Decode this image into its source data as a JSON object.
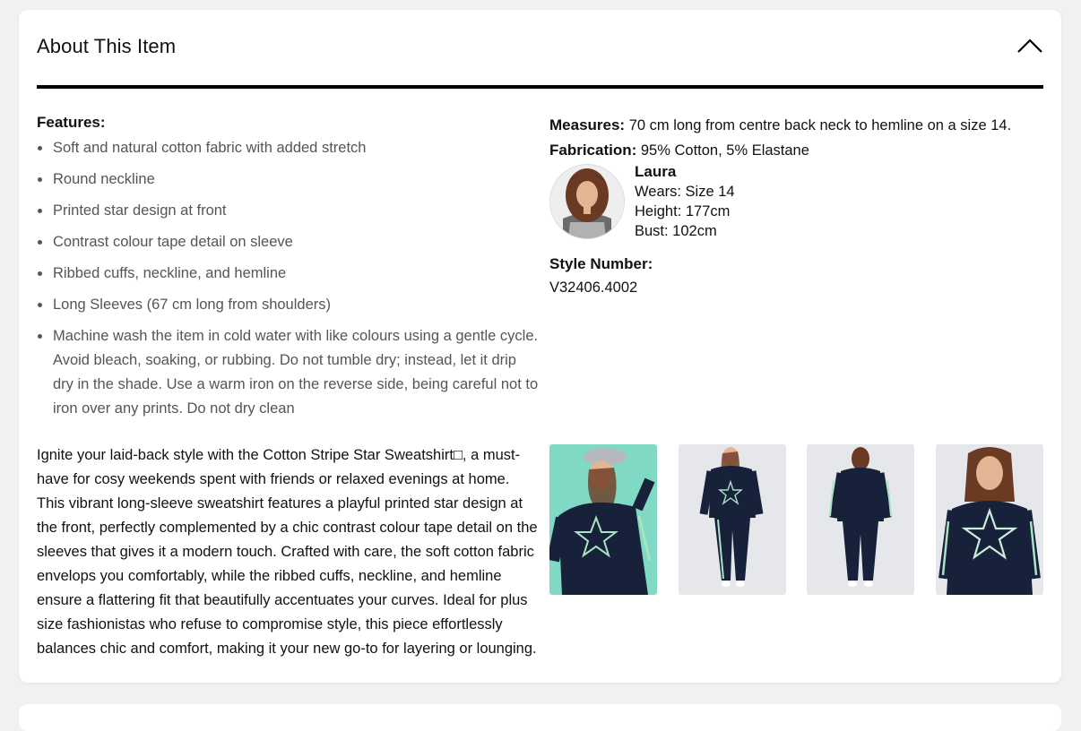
{
  "section": {
    "title": "About This Item"
  },
  "features": {
    "title": "Features:",
    "items": [
      "Soft and natural cotton fabric with added stretch",
      "Round neckline",
      "Printed star design at front",
      "Contrast colour tape detail on sleeve",
      "Ribbed cuffs, neckline, and hemline",
      "Long Sleeves (67 cm long from shoulders)",
      "Machine wash the item in cold water with like colours using a gentle cycle. Avoid bleach, soaking, or rubbing. Do not tumble dry; instead, let it drip dry in the shade. Use a warm iron on the reverse side, being careful not to iron over any prints. Do not dry clean"
    ]
  },
  "description": "Ignite your laid-back style with the Cotton Stripe Star Sweatshirt□, a must-have for cosy weekends spent with friends or relaxed evenings at home. This vibrant long-sleeve sweatshirt features a playful printed star design at the front, perfectly complemented by a chic contrast colour tape detail on the sleeves that gives it a modern touch. Crafted with care, the soft cotton fabric envelops you comfortably, while the ribbed cuffs, neckline, and hemline ensure a flattering fit that beautifully accentuates your curves. Ideal for plus size fashionistas who refuse to compromise style, this piece effortlessly balances chic and comfort, making it your new go-to for layering or lounging.",
  "specs": {
    "measures_label": "Measures:",
    "measures_value": " 70 cm long from centre back neck to hemline on a size 14.",
    "fabrication_label": "Fabrication:",
    "fabrication_value": " 95% Cotton, 5% Elastane"
  },
  "model": {
    "name": "Laura",
    "wears": "Wears: Size 14",
    "height": "Height: 177cm",
    "bust": "Bust: 102cm"
  },
  "style": {
    "label": "Style Number:",
    "value": "V32406.4002"
  },
  "colors": {
    "thumb1_bg": "#7fd9c4",
    "thumb_bg": "#e5e7ea",
    "garment": "#18213a",
    "stripe": "#a9e3c4"
  }
}
